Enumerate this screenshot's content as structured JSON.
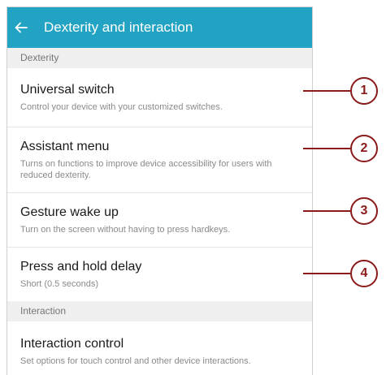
{
  "appbar": {
    "title": "Dexterity and interaction",
    "back_icon": "arrow-left-icon"
  },
  "sections": [
    {
      "header": "Dexterity",
      "items": [
        {
          "title": "Universal switch",
          "desc": "Control your device with your customized switches."
        },
        {
          "title": "Assistant menu",
          "desc": "Turns on functions to improve device accessibility for users with reduced dexterity."
        },
        {
          "title": "Gesture wake up",
          "desc": "Turn on the screen without having to press hardkeys."
        },
        {
          "title": "Press and hold delay",
          "desc": "Short (0.5 seconds)"
        }
      ]
    },
    {
      "header": "Interaction",
      "items": [
        {
          "title": "Interaction control",
          "desc": "Set options for touch control and other device interactions."
        }
      ]
    }
  ],
  "callouts": [
    "1",
    "2",
    "3",
    "4"
  ],
  "colors": {
    "appbar": "#23a3c3",
    "callout": "#8b1a1a",
    "section_bg": "#efefef"
  }
}
